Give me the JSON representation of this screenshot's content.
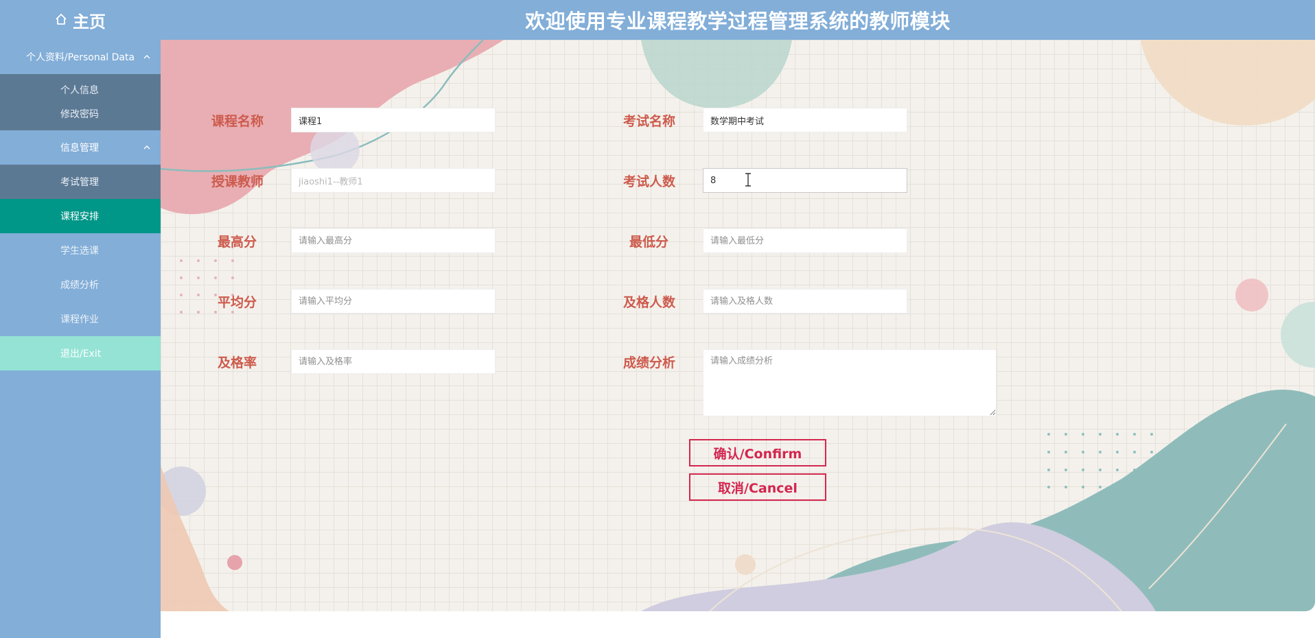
{
  "header": {
    "home_label": "主页",
    "home_icon": "home-icon",
    "title": "欢迎使用专业课程教学过程管理系统的教师模块"
  },
  "sidebar": {
    "group1": {
      "label": "个人资料/Personal Data",
      "items": [
        "个人信息",
        "修改密码"
      ]
    },
    "group2": {
      "label": "信息管理"
    },
    "items": [
      {
        "label": "考试管理",
        "state": "sub"
      },
      {
        "label": "课程安排",
        "state": "active"
      },
      {
        "label": "学生选课",
        "state": "normal"
      },
      {
        "label": "成绩分析",
        "state": "normal"
      },
      {
        "label": "课程作业",
        "state": "normal"
      },
      {
        "label": "退出/Exit",
        "state": "exit"
      }
    ]
  },
  "form": {
    "course_name": {
      "label": "课程名称",
      "value": "课程1"
    },
    "exam_name": {
      "label": "考试名称",
      "value": "数学期中考试"
    },
    "teacher": {
      "label": "授课教师",
      "value": "jiaoshi1--教师1"
    },
    "exam_count": {
      "label": "考试人数",
      "value": "8"
    },
    "max_score": {
      "label": "最高分",
      "placeholder": "请输入最高分"
    },
    "min_score": {
      "label": "最低分",
      "placeholder": "请输入最低分"
    },
    "avg_score": {
      "label": "平均分",
      "placeholder": "请输入平均分"
    },
    "pass_count": {
      "label": "及格人数",
      "placeholder": "请输入及格人数"
    },
    "pass_rate": {
      "label": "及格率",
      "placeholder": "请输入及格率"
    },
    "analysis": {
      "label": "成绩分析",
      "placeholder": "请输入成绩分析"
    }
  },
  "buttons": {
    "confirm": "确认/Confirm",
    "cancel": "取消/Cancel"
  },
  "colors": {
    "header_bg": "#82aed8",
    "sidebar_sub_bg": "#5c7994",
    "active_bg": "#009688",
    "exit_bg": "#95e3d5",
    "label_color": "#cd5a4c",
    "button_color": "#d3264f"
  }
}
